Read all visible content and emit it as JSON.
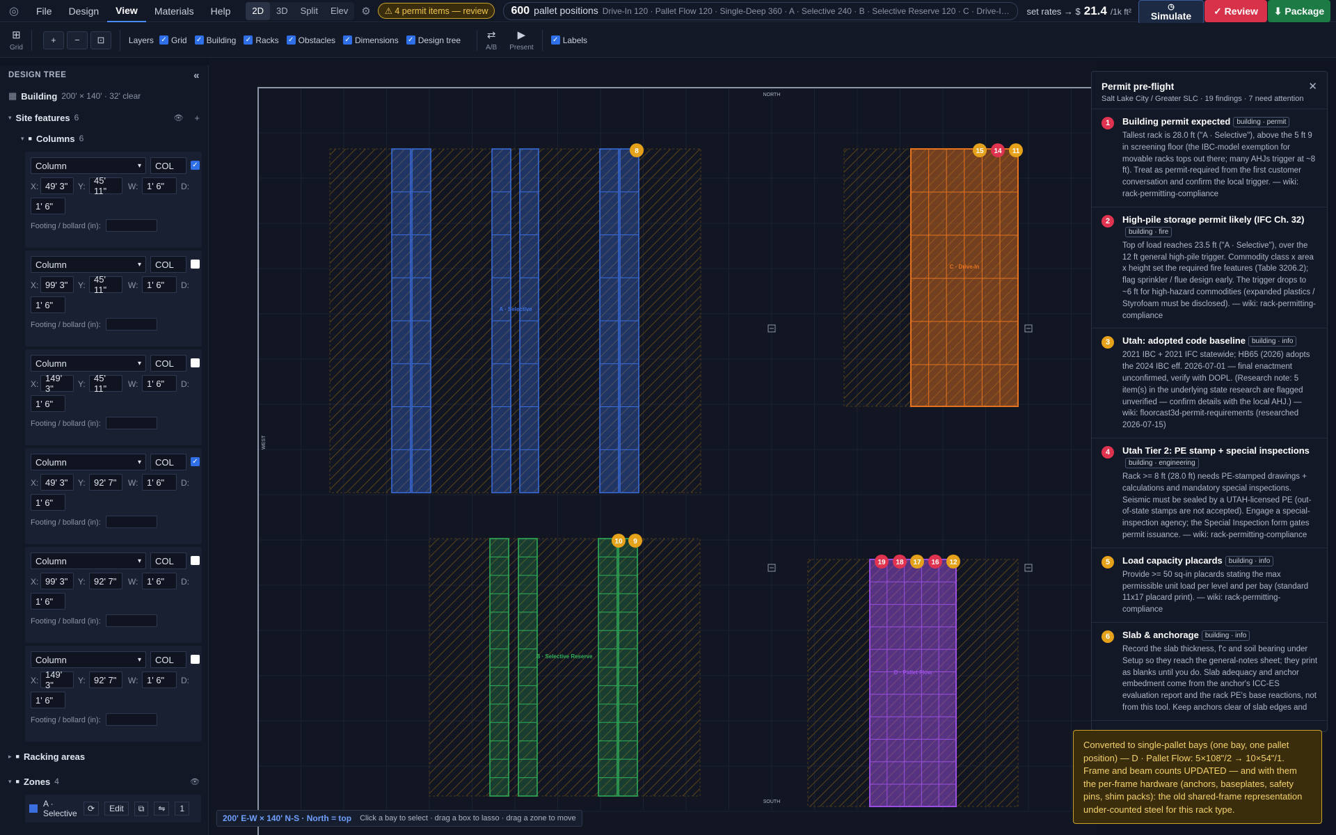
{
  "menu": [
    "File",
    "Design",
    "View",
    "Materials",
    "Help"
  ],
  "active_menu": "View",
  "view_modes": [
    "2D",
    "3D",
    "Split",
    "Elev"
  ],
  "active_view_mode": "2D",
  "permit_badge": "⚠ 4 permit items — review",
  "summary": {
    "pallet_count": "600",
    "pallet_label": "pallet positions",
    "breakdown": "Drive-In 120 · Pallet Flow 120 · Single-Deep 360 · A · Selective 240 · B · Selective Reserve 120 · C · Drive-In 120 · D · Pallet …"
  },
  "rates": {
    "label": "set rates → $",
    "value": "21.4",
    "unit": "/1k ft²"
  },
  "actions": {
    "simulate": "Simulate",
    "review": "✓ Review",
    "package": "⬇ Package"
  },
  "toolbar": {
    "grid_label": "Grid",
    "layers_label": "Layers",
    "layers": [
      {
        "label": "Grid",
        "checked": true
      },
      {
        "label": "Building",
        "checked": true
      },
      {
        "label": "Racks",
        "checked": true
      },
      {
        "label": "Obstacles",
        "checked": true
      },
      {
        "label": "Dimensions",
        "checked": true
      },
      {
        "label": "Design tree",
        "checked": true
      }
    ],
    "ab_label": "A/B",
    "present_label": "Present",
    "labels_toggle": "Labels"
  },
  "sidebar": {
    "title": "DESIGN TREE",
    "collapse": "«",
    "building_label": "Building",
    "building_desc": "200' × 140' · 32' clear",
    "site_features_label": "Site features",
    "site_features_count": "6",
    "columns_label": "Columns",
    "columns_count": "6",
    "columns": [
      {
        "type": "Column",
        "code": "COL",
        "x": "49' 3\"",
        "y": "45' 11\"",
        "w": "1' 6\"",
        "d": "1' 6\"",
        "checked": true
      },
      {
        "type": "Column",
        "code": "COL",
        "x": "99' 3\"",
        "y": "45' 11\"",
        "w": "1' 6\"",
        "d": "1' 6\"",
        "checked": false
      },
      {
        "type": "Column",
        "code": "COL",
        "x": "149' 3\"",
        "y": "45' 11\"",
        "w": "1' 6\"",
        "d": "1' 6\"",
        "checked": false
      },
      {
        "type": "Column",
        "code": "COL",
        "x": "49' 3\"",
        "y": "92' 7\"",
        "w": "1' 6\"",
        "d": "1' 6\"",
        "checked": true
      },
      {
        "type": "Column",
        "code": "COL",
        "x": "99' 3\"",
        "y": "92' 7\"",
        "w": "1' 6\"",
        "d": "1' 6\"",
        "checked": false
      },
      {
        "type": "Column",
        "code": "COL",
        "x": "149' 3\"",
        "y": "92' 7\"",
        "w": "1' 6\"",
        "d": "1' 6\"",
        "checked": false
      }
    ],
    "x_label": "X:",
    "y_label": "Y:",
    "w_label": "W:",
    "d_label": "D:",
    "footing_label": "Footing / bollard (in):",
    "racking_label": "Racking areas",
    "zones_label": "Zones",
    "zones_count": "4",
    "zone_first": "A · Selective",
    "zone_edit": "Edit",
    "zone_qty": "1"
  },
  "canvas": {
    "north": "NORTH",
    "south": "SOUTH",
    "west": "WEST",
    "zone_labels": [
      "A · Selective",
      "B · Selective Reserve",
      "C · Drive-In",
      "D · Pallet Flow"
    ],
    "markers": [
      "8",
      "15",
      "14",
      "11",
      "10",
      "9",
      "19",
      "18",
      "17",
      "16",
      "12"
    ],
    "status_dims": "200' E-W × 140' N-S · North = top",
    "status_hint": "Click a bay to select · drag a box to lasso · drag a zone to move"
  },
  "permit_panel": {
    "title": "Permit pre-flight",
    "subtitle": "Salt Lake City / Greater SLC · 19 findings · 7 need attention",
    "close": "✕",
    "findings": [
      {
        "n": "1",
        "severity": "red",
        "title": "Building permit expected",
        "tag": "building · permit",
        "body": "Tallest rack is 28.0 ft (\"A · Selective\"), above the 5 ft 9 in screening floor (the IBC-model exemption for movable racks tops out there; many AHJs trigger at ~8 ft). Treat as permit-required from the first customer conversation and confirm the local trigger. — wiki: rack-permitting-compliance"
      },
      {
        "n": "2",
        "severity": "red",
        "title": "High-pile storage permit likely (IFC Ch. 32)",
        "tag": "building · fire",
        "body": "Top of load reaches 23.5 ft (\"A · Selective\"), over the 12 ft general high-pile trigger. Commodity class x area x height set the required fire features (Table 3206.2); flag sprinkler / flue design early. The trigger drops to ~6 ft for high-hazard commodities (expanded plastics / Styrofoam must be disclosed). — wiki: rack-permitting-compliance"
      },
      {
        "n": "3",
        "severity": "amber",
        "title": "Utah: adopted code baseline",
        "tag": "building · info",
        "body": "2021 IBC + 2021 IFC statewide; HB65 (2026) adopts the 2024 IBC eff. 2026-07-01 — final enactment unconfirmed, verify with DOPL. (Research note: 5 item(s) in the underlying state research are flagged unverified — confirm details with the local AHJ.) — wiki: floorcast3d-permit-requirements (researched 2026-07-15)"
      },
      {
        "n": "4",
        "severity": "red",
        "title": "Utah Tier 2: PE stamp + special inspections",
        "tag": "building · engineering",
        "body": "Rack >= 8 ft (28.0 ft) needs PE-stamped drawings + calculations and mandatory special inspections. Seismic must be sealed by a UTAH-licensed PE (out-of-state stamps are not accepted). Engage a special-inspection agency; the Special Inspection form gates permit issuance. — wiki: rack-permitting-compliance"
      },
      {
        "n": "5",
        "severity": "amber",
        "title": "Load capacity placards",
        "tag": "building · info",
        "body": "Provide >= 50 sq-in placards stating the max permissible unit load per level and per bay (standard 11x17 placard print). — wiki: rack-permitting-compliance"
      },
      {
        "n": "6",
        "severity": "amber",
        "title": "Slab & anchorage",
        "tag": "building · info",
        "body": "Record the slab thickness, f'c and soil bearing under Setup so they reach the general-notes sheet; they print as blanks until you do. Slab adequacy and anchor embedment come from the anchor's ICC-ES evaluation report and the rack PE's base reactions, not from this tool. Keep anchors clear of slab edges and"
      }
    ]
  },
  "toast": "Converted to single-pallet bays (one bay, one pallet position) — D · Pallet Flow: 5×108\"/2 → 10×54\"/1. Frame and beam counts UPDATED — and with them the per-frame hardware (anchors, baseplates, safety pins, shim packs): the old shared-frame representation under-counted steel for this rack type.",
  "colors": {
    "zone_a": "#3b6fe0",
    "zone_b": "#2fb35a",
    "zone_c": "#e8731f",
    "zone_d": "#9a4fe0",
    "marker_red": "#e0334f",
    "marker_amber": "#e6a11a"
  }
}
